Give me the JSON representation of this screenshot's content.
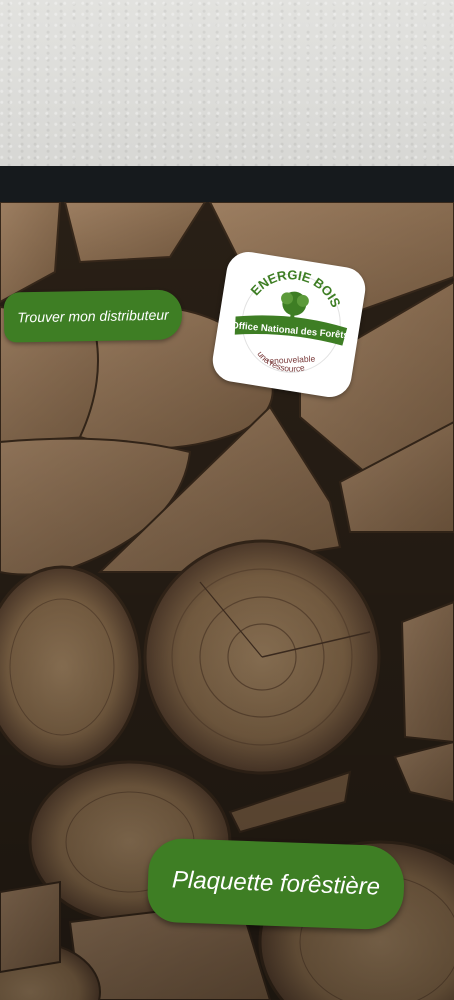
{
  "distributor_button": {
    "label": "Trouver mon distributeur"
  },
  "logo": {
    "title": "ENERGIE BOIS",
    "band": "Office National des Forêts",
    "tagline_1": "une ressource",
    "tagline_2": "renouvelable"
  },
  "cta_button": {
    "label": "Plaquette forêstière"
  },
  "colors": {
    "brand_green": "#3e7e24",
    "wall": "#dcdcd9",
    "bezel": "#161a1d"
  }
}
